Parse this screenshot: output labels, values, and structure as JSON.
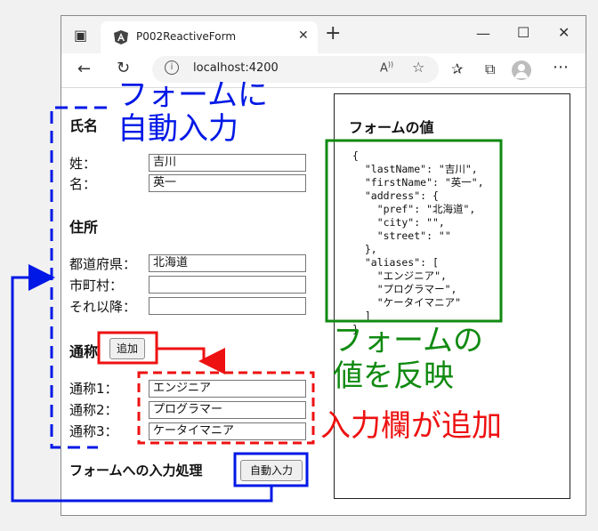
{
  "browser": {
    "tab_title": "P002ReactiveForm",
    "tab_close": "✕",
    "new_tab": "+",
    "url": "localhost:4200",
    "controls": {
      "minimize": "—",
      "maximize": "☐",
      "close": "✕"
    }
  },
  "form": {
    "name_heading": "氏名",
    "last_name_label": "姓：",
    "last_name_value": "吉川",
    "first_name_label": "名：",
    "first_name_value": "英一",
    "address_heading": "住所",
    "pref_label": "都道府県：",
    "pref_value": "北海道",
    "city_label": "市町村：",
    "city_value": "",
    "street_label": "それ以降：",
    "street_value": "",
    "alias_heading": "通称",
    "add_button": "追加",
    "aliases": [
      {
        "label": "通称1：",
        "value": "エンジニア"
      },
      {
        "label": "通称2：",
        "value": "プログラマー"
      },
      {
        "label": "通称3：",
        "value": "ケータイマニア"
      }
    ],
    "auto_heading": "フォームへの入力処理",
    "auto_button": "自動入力"
  },
  "preview": {
    "heading": "フォームの値",
    "json": "{\n  \"lastName\": \"吉川\",\n  \"firstName\": \"英一\",\n  \"address\": {\n    \"pref\": \"北海道\",\n    \"city\": \"\",\n    \"street\": \"\"\n  },\n  \"aliases\": [\n    \"エンジニア\",\n    \"プログラマー\",\n    \"ケータイマニア\"\n  ]\n}"
  },
  "annotations": {
    "auto_fill_1": "フォームに",
    "auto_fill_2": "自動入力",
    "reflect_1": "フォームの",
    "reflect_2": "値を反映",
    "added": "入力欄が追加",
    "colors": {
      "blue": "#0018e6",
      "green": "#108a10",
      "red": "#ee1111"
    }
  }
}
